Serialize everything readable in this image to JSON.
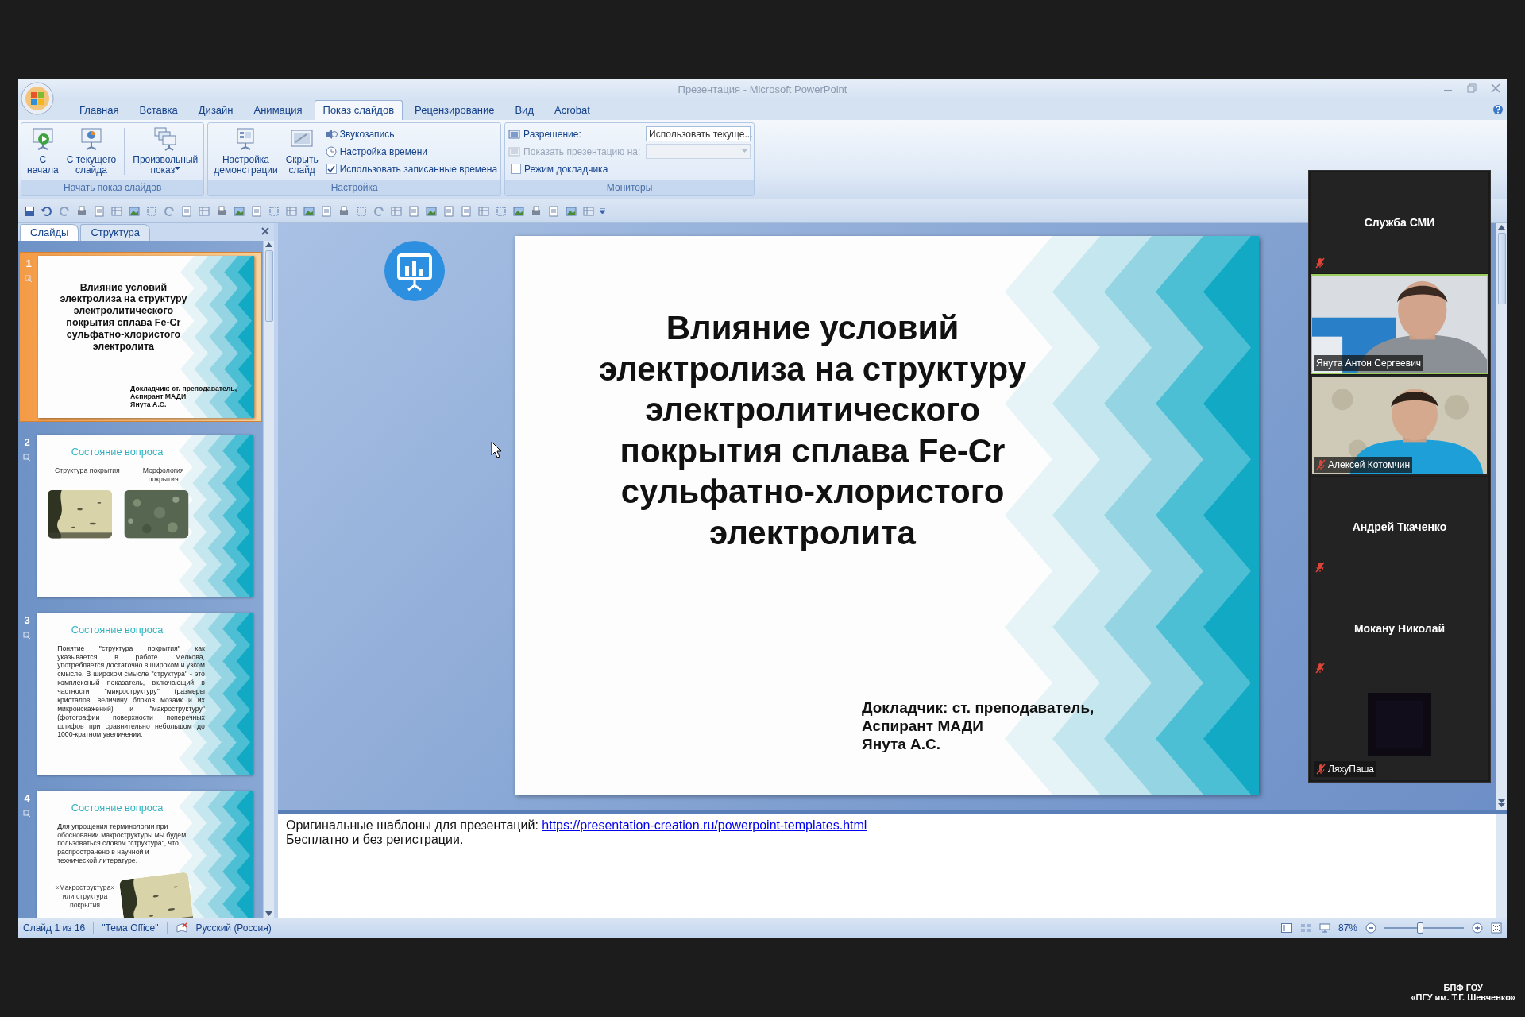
{
  "window": {
    "title": "Презентация - Microsoft PowerPoint"
  },
  "ribbon_tabs": [
    {
      "label": "Главная",
      "selected": false
    },
    {
      "label": "Вставка",
      "selected": false
    },
    {
      "label": "Дизайн",
      "selected": false
    },
    {
      "label": "Анимация",
      "selected": false
    },
    {
      "label": "Показ слайдов",
      "selected": true
    },
    {
      "label": "Рецензирование",
      "selected": false
    },
    {
      "label": "Вид",
      "selected": false
    },
    {
      "label": "Acrobat",
      "selected": false
    }
  ],
  "ribbon_groups": [
    {
      "label": "Начать показ слайдов",
      "large_buttons": [
        {
          "lines": [
            "С",
            "начала"
          ],
          "dropdown": false
        },
        {
          "lines": [
            "С текущего",
            "слайда"
          ],
          "dropdown": false
        },
        {
          "lines": [
            "Произвольный",
            "показ"
          ],
          "dropdown": true
        }
      ]
    },
    {
      "label": "Настройка",
      "large_buttons": [
        {
          "lines": [
            "Настройка",
            "демонстрации"
          ],
          "dropdown": false
        },
        {
          "lines": [
            "Скрыть",
            "слайд"
          ],
          "dropdown": false
        }
      ],
      "small_items": [
        {
          "kind": "button",
          "label": "Звукозапись"
        },
        {
          "kind": "button",
          "label": "Настройка времени"
        },
        {
          "kind": "checkbox",
          "label": "Использовать записанные времена",
          "checked": true
        }
      ]
    },
    {
      "label": "Мониторы",
      "small_items": [
        {
          "kind": "dropdown",
          "label": "Разрешение:",
          "value": "Использовать текуще...",
          "disabled": false
        },
        {
          "kind": "dropdown",
          "label": "Показать презентацию на:",
          "disabled": true
        },
        {
          "kind": "checkbox",
          "label": "Режим докладчика",
          "checked": false
        }
      ]
    }
  ],
  "pane_tabs": [
    {
      "label": "Слайды",
      "selected": true
    },
    {
      "label": "Структура",
      "selected": false
    }
  ],
  "slides": [
    {
      "number": "1",
      "kind": "title",
      "selected": true,
      "title_lines": [
        "Влияние условий",
        "электролиза на структуру",
        "электролитического",
        "покрытия сплава Fe-Cr",
        "сульфатно-хлористого",
        "электролита"
      ],
      "presenter_lines": [
        "Докладчик: ст. преподаватель,",
        "Аспирант МАДИ",
        "Янута А.С."
      ]
    },
    {
      "number": "2",
      "kind": "photos",
      "selected": false,
      "title": "Состояние вопроса",
      "captions": [
        "Структура покрытия",
        "Морфология покрытия"
      ]
    },
    {
      "number": "3",
      "kind": "text",
      "selected": false,
      "title": "Состояние вопроса",
      "body": "Понятие \"структура покрытия\" как указывается в работе Мелкова, употребляется достаточно в широком и узком смысле. В широком смысле \"структура\" - это комплексный показатель, включающий в частности \"микроструктуру\" (размеры кристалов, величину блоков мозаик и их микроискажений) и \"макроструктуру\" (фотографии поверхности поперечных шлифов при сравнительно небольшом до 1000-кратном увеличении."
    },
    {
      "number": "4",
      "kind": "text-photo",
      "selected": false,
      "title": "Состояние вопроса",
      "body": "Для упрощения терминологии при обосновании макроструктуры мы будем пользоваться словом \"структура\", что распространено в научной и технической литературе.",
      "caption": "«Макроструктура» или структура покрытия"
    }
  ],
  "current_slide": {
    "title_lines": [
      "Влияние условий",
      "электролиза на структуру",
      "электролитического",
      "покрытия сплава Fe-Cr",
      "сульфатно-хлористого",
      "электролита"
    ],
    "presenter_lines": [
      "Докладчик: ст. преподаватель,",
      "Аспирант МАДИ",
      "Янута А.С."
    ]
  },
  "notes": {
    "text": "Оригинальные шаблоны для презентаций:",
    "link": "https://presentation-creation.ru/powerpoint-templates.html",
    "second_line": "Бесплатно и без регистрации."
  },
  "status_bar": {
    "slide": "Слайд 1 из 16",
    "theme": "\"Тема Office\"",
    "language": "Русский (Россия)",
    "zoom": "87%",
    "zoom_slider": {
      "level": 0.45
    }
  },
  "participants": [
    {
      "name": "Служба СМИ",
      "kind": "name",
      "muted": true,
      "speaking": false
    },
    {
      "name": "Янута Антон Сергеевич",
      "kind": "video",
      "muted": false,
      "speaking": true
    },
    {
      "name": "Алексей Котомчин",
      "kind": "video",
      "muted": true,
      "speaking": false
    },
    {
      "name": "Андрей Ткаченко",
      "kind": "name",
      "muted": true,
      "speaking": false
    },
    {
      "name": "Мокану Николай",
      "kind": "name",
      "muted": true,
      "speaking": false
    },
    {
      "name": "ЛяхуПаша",
      "kind": "dark-video",
      "muted": true,
      "speaking": false
    }
  ],
  "broadcaster_caption": {
    "lines": [
      "БПФ ГОУ",
      "«ПГУ им. Т.Г. Шевченко»"
    ]
  }
}
